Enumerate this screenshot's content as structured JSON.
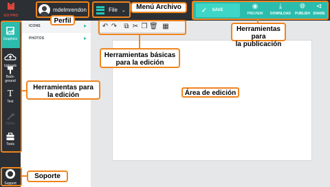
{
  "topbar": {
    "logo_text": "GO PRO",
    "username": "mdelmrendon",
    "file_menu": {
      "label": "File"
    },
    "publish": {
      "save_label": "SAVE",
      "preview_label": "PREVIEW",
      "download_label": "DOWNLOAD",
      "publish_label": "PUBLISH",
      "share_label": "SHARE"
    }
  },
  "sidebar": {
    "items": [
      {
        "label": "Graphics",
        "icon": "image-icon",
        "active": true
      },
      {
        "label": "Uploads",
        "icon": "upload-cloud-icon"
      },
      {
        "label": "Back-",
        "label2": "ground",
        "icon": "paint-brush-icon"
      },
      {
        "label": "Text",
        "icon": "text-t-icon"
      },
      {
        "label": "Styles",
        "icon": "magic-wand-icon",
        "disabled": true
      },
      {
        "label": "Tools",
        "icon": "toolbox-icon"
      }
    ],
    "support_label": "Support"
  },
  "panel": {
    "rows": [
      {
        "label": "ICONS"
      },
      {
        "label": "PHOTOS"
      }
    ]
  },
  "toolbar": {
    "buttons": [
      "undo-icon",
      "redo-icon",
      "duplicate-icon",
      "cut-icon",
      "copy-icon",
      "delete-icon",
      "align-icon"
    ]
  },
  "annotations": {
    "perfil": "Perfil",
    "menu_archivo": "Menú Archivo",
    "herramientas_publicacion_1": "Herramientas para",
    "herramientas_publicacion_2": "la publicación",
    "herramientas_basicas_1": "Herramientas básicas",
    "herramientas_basicas_2": "para la edición",
    "herramientas_edicion_1": "Herramientas para",
    "herramientas_edicion_2": "la edición",
    "area_edicion": "Área de edición",
    "soporte": "Soporte"
  },
  "colors": {
    "dark_bg": "#2c2f33",
    "accent_teal": "#2bbcad",
    "save_teal": "#3ed6c6",
    "annotation_orange": "#f0841c",
    "workspace_gray": "#e6e7e9",
    "logo_red": "#e0453c"
  }
}
